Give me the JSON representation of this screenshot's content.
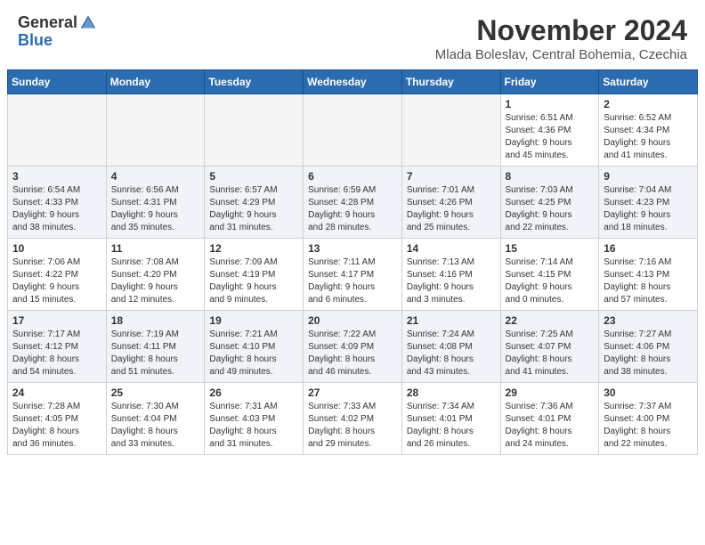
{
  "header": {
    "logo_general": "General",
    "logo_blue": "Blue",
    "month_title": "November 2024",
    "location": "Mlada Boleslav, Central Bohemia, Czechia"
  },
  "weekdays": [
    "Sunday",
    "Monday",
    "Tuesday",
    "Wednesday",
    "Thursday",
    "Friday",
    "Saturday"
  ],
  "weeks": [
    [
      {
        "day": "",
        "info": ""
      },
      {
        "day": "",
        "info": ""
      },
      {
        "day": "",
        "info": ""
      },
      {
        "day": "",
        "info": ""
      },
      {
        "day": "",
        "info": ""
      },
      {
        "day": "1",
        "info": "Sunrise: 6:51 AM\nSunset: 4:36 PM\nDaylight: 9 hours\nand 45 minutes."
      },
      {
        "day": "2",
        "info": "Sunrise: 6:52 AM\nSunset: 4:34 PM\nDaylight: 9 hours\nand 41 minutes."
      }
    ],
    [
      {
        "day": "3",
        "info": "Sunrise: 6:54 AM\nSunset: 4:33 PM\nDaylight: 9 hours\nand 38 minutes."
      },
      {
        "day": "4",
        "info": "Sunrise: 6:56 AM\nSunset: 4:31 PM\nDaylight: 9 hours\nand 35 minutes."
      },
      {
        "day": "5",
        "info": "Sunrise: 6:57 AM\nSunset: 4:29 PM\nDaylight: 9 hours\nand 31 minutes."
      },
      {
        "day": "6",
        "info": "Sunrise: 6:59 AM\nSunset: 4:28 PM\nDaylight: 9 hours\nand 28 minutes."
      },
      {
        "day": "7",
        "info": "Sunrise: 7:01 AM\nSunset: 4:26 PM\nDaylight: 9 hours\nand 25 minutes."
      },
      {
        "day": "8",
        "info": "Sunrise: 7:03 AM\nSunset: 4:25 PM\nDaylight: 9 hours\nand 22 minutes."
      },
      {
        "day": "9",
        "info": "Sunrise: 7:04 AM\nSunset: 4:23 PM\nDaylight: 9 hours\nand 18 minutes."
      }
    ],
    [
      {
        "day": "10",
        "info": "Sunrise: 7:06 AM\nSunset: 4:22 PM\nDaylight: 9 hours\nand 15 minutes."
      },
      {
        "day": "11",
        "info": "Sunrise: 7:08 AM\nSunset: 4:20 PM\nDaylight: 9 hours\nand 12 minutes."
      },
      {
        "day": "12",
        "info": "Sunrise: 7:09 AM\nSunset: 4:19 PM\nDaylight: 9 hours\nand 9 minutes."
      },
      {
        "day": "13",
        "info": "Sunrise: 7:11 AM\nSunset: 4:17 PM\nDaylight: 9 hours\nand 6 minutes."
      },
      {
        "day": "14",
        "info": "Sunrise: 7:13 AM\nSunset: 4:16 PM\nDaylight: 9 hours\nand 3 minutes."
      },
      {
        "day": "15",
        "info": "Sunrise: 7:14 AM\nSunset: 4:15 PM\nDaylight: 9 hours\nand 0 minutes."
      },
      {
        "day": "16",
        "info": "Sunrise: 7:16 AM\nSunset: 4:13 PM\nDaylight: 8 hours\nand 57 minutes."
      }
    ],
    [
      {
        "day": "17",
        "info": "Sunrise: 7:17 AM\nSunset: 4:12 PM\nDaylight: 8 hours\nand 54 minutes."
      },
      {
        "day": "18",
        "info": "Sunrise: 7:19 AM\nSunset: 4:11 PM\nDaylight: 8 hours\nand 51 minutes."
      },
      {
        "day": "19",
        "info": "Sunrise: 7:21 AM\nSunset: 4:10 PM\nDaylight: 8 hours\nand 49 minutes."
      },
      {
        "day": "20",
        "info": "Sunrise: 7:22 AM\nSunset: 4:09 PM\nDaylight: 8 hours\nand 46 minutes."
      },
      {
        "day": "21",
        "info": "Sunrise: 7:24 AM\nSunset: 4:08 PM\nDaylight: 8 hours\nand 43 minutes."
      },
      {
        "day": "22",
        "info": "Sunrise: 7:25 AM\nSunset: 4:07 PM\nDaylight: 8 hours\nand 41 minutes."
      },
      {
        "day": "23",
        "info": "Sunrise: 7:27 AM\nSunset: 4:06 PM\nDaylight: 8 hours\nand 38 minutes."
      }
    ],
    [
      {
        "day": "24",
        "info": "Sunrise: 7:28 AM\nSunset: 4:05 PM\nDaylight: 8 hours\nand 36 minutes."
      },
      {
        "day": "25",
        "info": "Sunrise: 7:30 AM\nSunset: 4:04 PM\nDaylight: 8 hours\nand 33 minutes."
      },
      {
        "day": "26",
        "info": "Sunrise: 7:31 AM\nSunset: 4:03 PM\nDaylight: 8 hours\nand 31 minutes."
      },
      {
        "day": "27",
        "info": "Sunrise: 7:33 AM\nSunset: 4:02 PM\nDaylight: 8 hours\nand 29 minutes."
      },
      {
        "day": "28",
        "info": "Sunrise: 7:34 AM\nSunset: 4:01 PM\nDaylight: 8 hours\nand 26 minutes."
      },
      {
        "day": "29",
        "info": "Sunrise: 7:36 AM\nSunset: 4:01 PM\nDaylight: 8 hours\nand 24 minutes."
      },
      {
        "day": "30",
        "info": "Sunrise: 7:37 AM\nSunset: 4:00 PM\nDaylight: 8 hours\nand 22 minutes."
      }
    ]
  ]
}
